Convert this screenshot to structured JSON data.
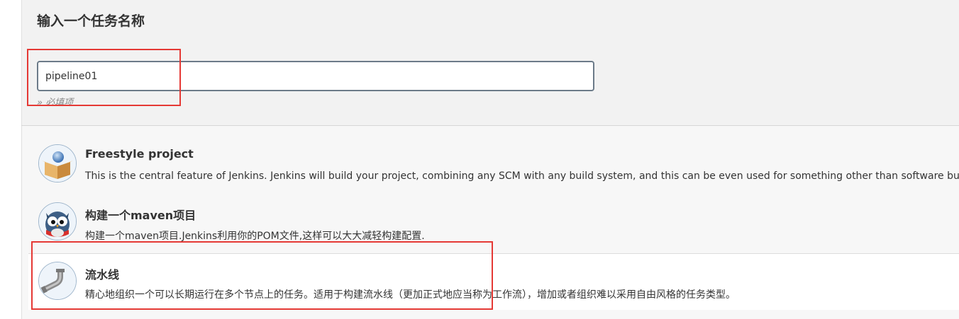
{
  "form": {
    "title": "输入一个任务名称",
    "name_value": "pipeline01",
    "required_hint": "» 必填项"
  },
  "job_types": [
    {
      "title": "Freestyle project",
      "description": "This is the central feature of Jenkins. Jenkins will build your project, combining any SCM with any build system, and this can be even used for something other than software build",
      "icon": "freestyle-box-icon"
    },
    {
      "title": "构建一个maven项目",
      "description": "构建一个maven项目.Jenkins利用你的POM文件,这样可以大大减轻构建配置.",
      "icon": "maven-owl-icon"
    },
    {
      "title": "流水线",
      "description": "精心地组织一个可以长期运行在多个节点上的任务。适用于构建流水线（更加正式地应当称为工作流），增加或者组织难以采用自由风格的任务类型。",
      "icon": "pipeline-icon"
    }
  ],
  "colors": {
    "highlight": "#e53935",
    "input_border": "#6c7b89"
  }
}
